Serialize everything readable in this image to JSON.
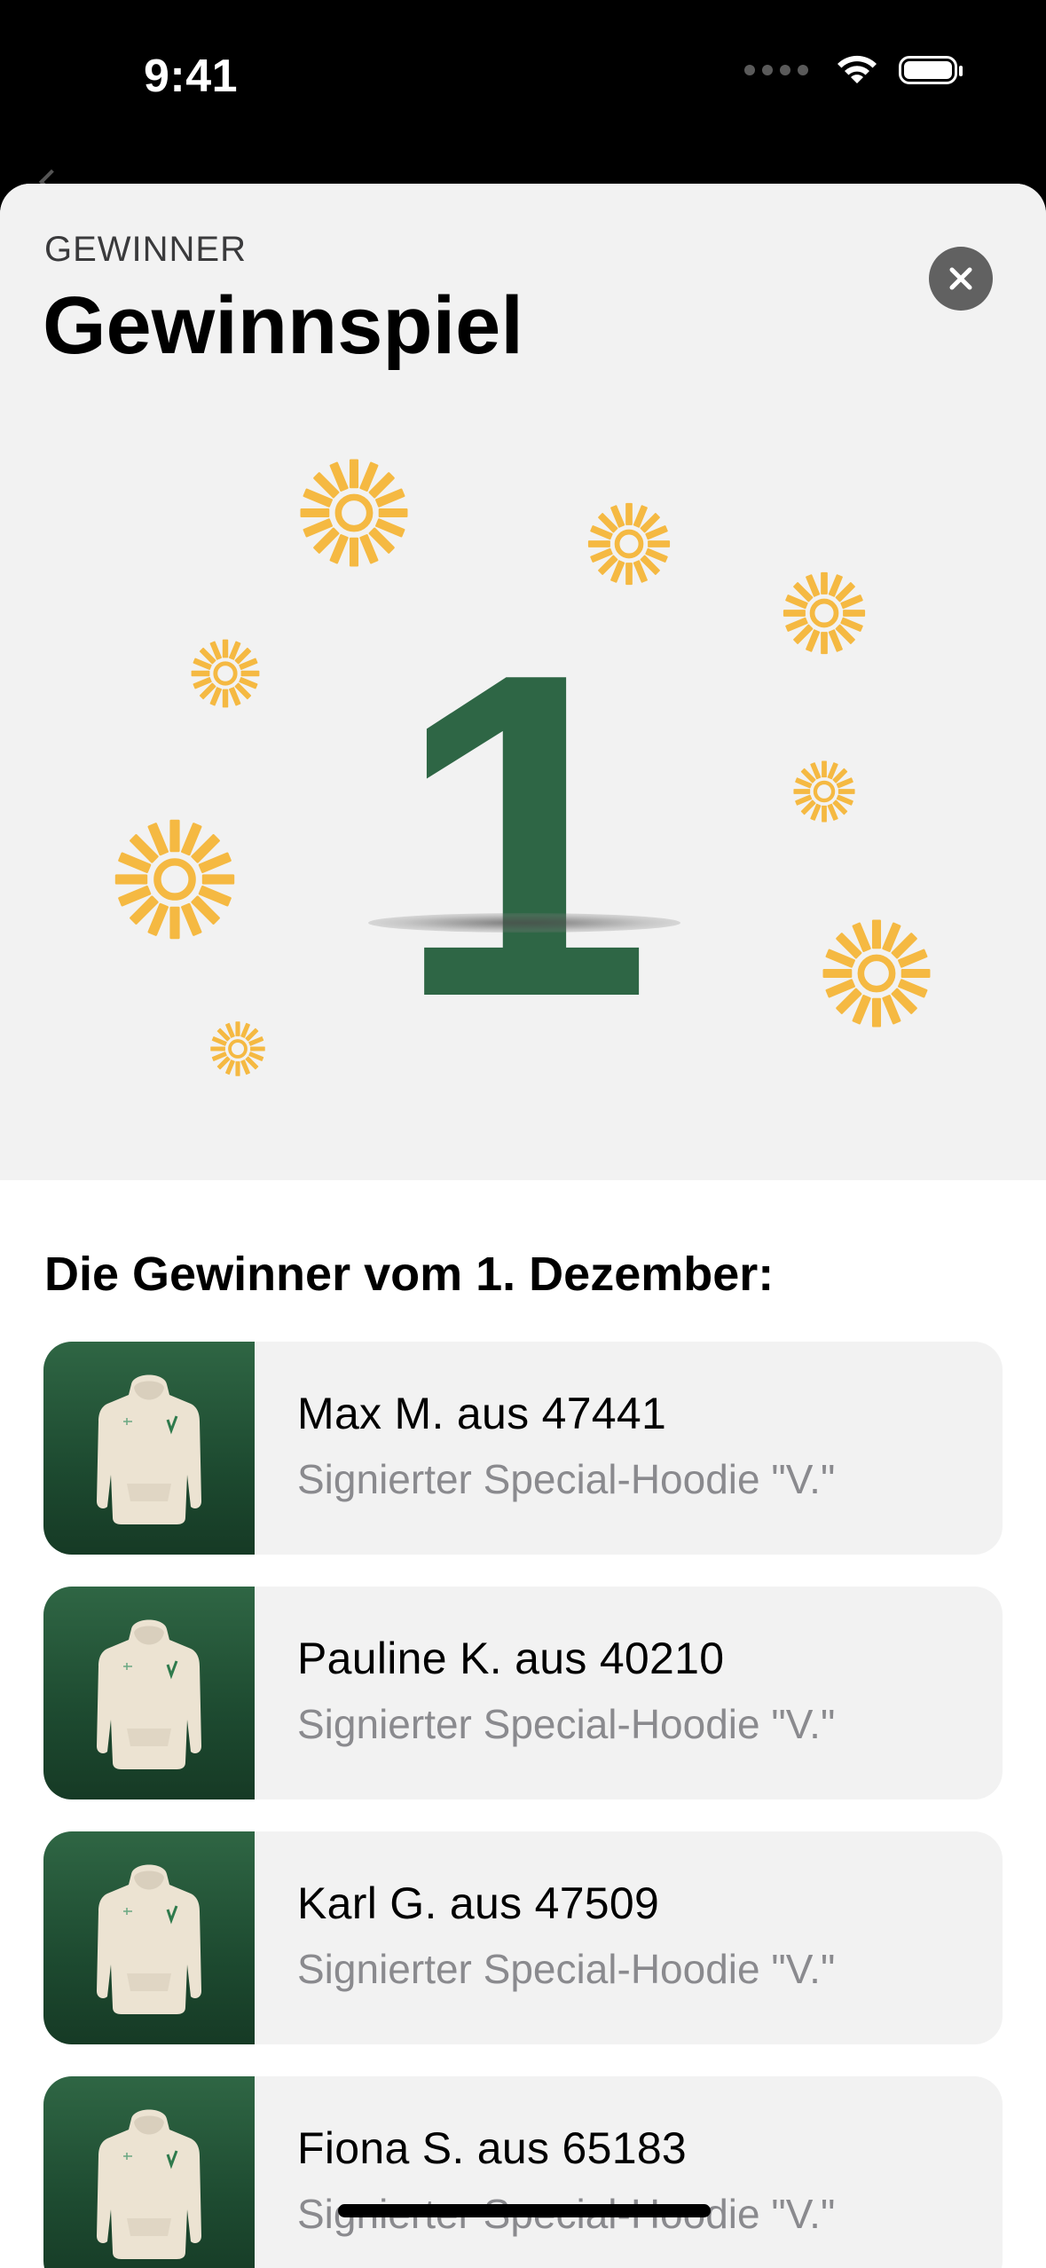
{
  "status_bar": {
    "time": "9:41"
  },
  "sheet": {
    "eyebrow": "GEWINNER",
    "title": "Gewinnspiel",
    "close_icon": "close-icon",
    "day_number": "1",
    "section_heading": "Die Gewinner vom 1. Dezember:"
  },
  "colors": {
    "accent_green": "#2e6645",
    "sun_yellow": "#f5b942",
    "close_button": "#616161"
  },
  "winners": [
    {
      "name": "Max M. aus 47441",
      "prize": "Signierter Special-Hoodie \"V.\""
    },
    {
      "name": "Pauline K. aus 40210",
      "prize": "Signierter Special-Hoodie \"V.\""
    },
    {
      "name": "Karl G. aus 47509",
      "prize": "Signierter Special-Hoodie \"V.\""
    },
    {
      "name": "Fiona S. aus 65183",
      "prize": "Signierter Special-Hoodie \"V.\""
    }
  ]
}
